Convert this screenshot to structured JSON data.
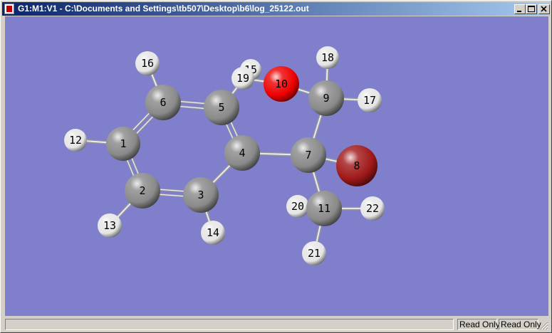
{
  "window": {
    "title": "G1:M1:V1 - C:\\Documents and Settings\\tb507\\Desktop\\b6\\log_25122.out",
    "controls": [
      "minimize-icon",
      "maximize-icon",
      "close-icon"
    ]
  },
  "viewport": {
    "background": "#7f7fcc"
  },
  "molecule": {
    "atoms": [
      {
        "id": "1",
        "element": "C",
        "color": "#8a8a8a"
      },
      {
        "id": "2",
        "element": "C",
        "color": "#8a8a8a"
      },
      {
        "id": "3",
        "element": "C",
        "color": "#8a8a8a"
      },
      {
        "id": "4",
        "element": "C",
        "color": "#8a8a8a"
      },
      {
        "id": "5",
        "element": "C",
        "color": "#8a8a8a"
      },
      {
        "id": "6",
        "element": "C",
        "color": "#8a8a8a"
      },
      {
        "id": "7",
        "element": "C",
        "color": "#8a8a8a"
      },
      {
        "id": "8",
        "element": "Br",
        "color": "#a01818"
      },
      {
        "id": "9",
        "element": "C",
        "color": "#8a8a8a"
      },
      {
        "id": "10",
        "element": "O",
        "color": "#ee0000"
      },
      {
        "id": "11",
        "element": "C",
        "color": "#8a8a8a"
      },
      {
        "id": "12",
        "element": "H",
        "color": "#e6e6e6"
      },
      {
        "id": "13",
        "element": "H",
        "color": "#e6e6e6"
      },
      {
        "id": "14",
        "element": "H",
        "color": "#e6e6e6"
      },
      {
        "id": "15",
        "element": "H",
        "color": "#e6e6e6"
      },
      {
        "id": "16",
        "element": "H",
        "color": "#e6e6e6"
      },
      {
        "id": "17",
        "element": "H",
        "color": "#e6e6e6"
      },
      {
        "id": "18",
        "element": "H",
        "color": "#e6e6e6"
      },
      {
        "id": "19",
        "element": "H",
        "color": "#e6e6e6"
      },
      {
        "id": "20",
        "element": "H",
        "color": "#e6e6e6"
      },
      {
        "id": "21",
        "element": "H",
        "color": "#e6e6e6"
      },
      {
        "id": "22",
        "element": "H",
        "color": "#e6e6e6"
      }
    ],
    "bonds": [
      {
        "a": "1",
        "b": "2",
        "order": 2
      },
      {
        "a": "2",
        "b": "3",
        "order": 2
      },
      {
        "a": "3",
        "b": "4",
        "order": 1
      },
      {
        "a": "4",
        "b": "5",
        "order": 2
      },
      {
        "a": "5",
        "b": "6",
        "order": 2
      },
      {
        "a": "6",
        "b": "1",
        "order": 2
      },
      {
        "a": "1",
        "b": "12",
        "order": 1
      },
      {
        "a": "2",
        "b": "13",
        "order": 1
      },
      {
        "a": "3",
        "b": "14",
        "order": 1
      },
      {
        "a": "6",
        "b": "16",
        "order": 1
      },
      {
        "a": "5",
        "b": "15",
        "order": 1
      },
      {
        "a": "4",
        "b": "7",
        "order": 1
      },
      {
        "a": "7",
        "b": "8",
        "order": 1
      },
      {
        "a": "7",
        "b": "9",
        "order": 1
      },
      {
        "a": "7",
        "b": "11",
        "order": 1
      },
      {
        "a": "9",
        "b": "10",
        "order": 1
      },
      {
        "a": "9",
        "b": "17",
        "order": 1
      },
      {
        "a": "9",
        "b": "18",
        "order": 1
      },
      {
        "a": "10",
        "b": "19",
        "order": 1
      },
      {
        "a": "11",
        "b": "20",
        "order": 1
      },
      {
        "a": "11",
        "b": "21",
        "order": 1
      },
      {
        "a": "11",
        "b": "22",
        "order": 1
      }
    ]
  },
  "statusbar": {
    "message": "",
    "cells": [
      "Read Only",
      "Read Only"
    ]
  }
}
